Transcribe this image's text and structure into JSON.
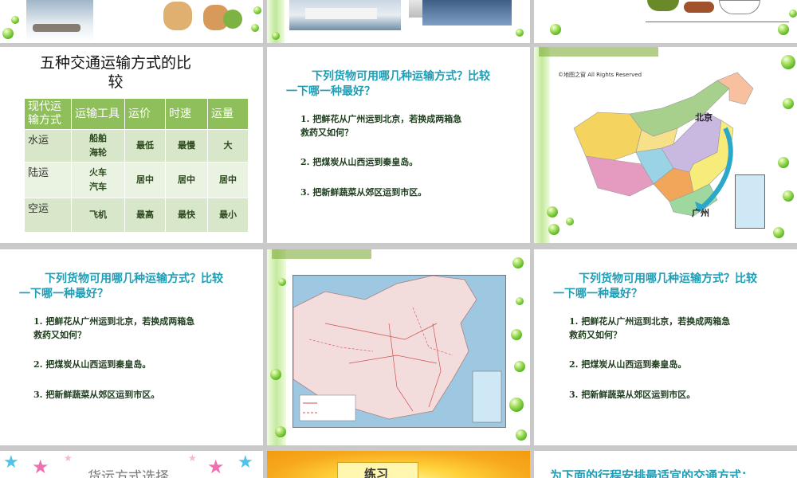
{
  "slide_r1c1": {
    "title_line1": "五种交通运输方式的比",
    "title_line2": "较",
    "table": {
      "headers": [
        "现代运输方式",
        "运输工具",
        "运价",
        "时速",
        "运量"
      ],
      "header_col1_line1": "现代运",
      "header_col1_line2": "输方式",
      "rows": [
        {
          "mode": "水运",
          "tool1": "船舶",
          "tool2": "海轮",
          "price": "最低",
          "speed": "最慢",
          "volume": "大"
        },
        {
          "mode": "陆运",
          "tool1": "火车",
          "tool2": "汽车",
          "price": "居中",
          "speed": "居中",
          "volume": "居中"
        },
        {
          "mode": "空运",
          "tool1": "飞机",
          "tool2": "",
          "price": "最高",
          "speed": "最快",
          "volume": "最小"
        }
      ]
    }
  },
  "slide_r1c2": {
    "question_line1": "下列货物可用哪几种运输方式？比较",
    "question_line2": "一下哪一种最好？",
    "item1_line1": "1. 把鲜花从广州运到北京，若换成两箱急",
    "item1_line2": "救药又如何？",
    "item2": "2. 把煤炭从山西运到秦皇岛。",
    "item3": "3. 把新鲜蔬菜从郊区运到市区。"
  },
  "slide_r1c3": {
    "map_copyright": "©地图之窗 All Rights Reserved",
    "label_beijing": "北京",
    "label_guangzhou": "广州"
  },
  "slide_r2c1": {
    "question_line1": "下列货物可用哪几种运输方式？比较",
    "question_line2": "一下哪一种最好？",
    "item1_line1": "1. 把鲜花从广州运到北京，若换成两箱急",
    "item1_line2": "救药又如何？",
    "item2": "2. 把煤炭从山西运到秦皇岛。",
    "item3": "3. 把新鲜蔬菜从郊区运到市区。"
  },
  "slide_r2c3": {
    "question_line1": "下列货物可用哪几种运输方式？比较",
    "question_line2": "一下哪一种最好？",
    "item1_line1": "1. 把鲜花从广州运到北京，若换成两箱急",
    "item1_line2": "救药又如何？",
    "item2": "2. 把煤炭从山西运到秦皇岛。",
    "item3": "3. 把新鲜蔬菜从郊区运到市区。"
  },
  "slide_r3c1": {
    "title": "货运方式选择"
  },
  "slide_r3c2": {
    "title": "练习"
  },
  "slide_r3c3": {
    "title": "为下面的行程安排最适宜的交通方式："
  },
  "colors": {
    "accent_teal": "#1f9db5",
    "table_header": "#8fbf5a",
    "bubble_green": "#5fb82a"
  }
}
